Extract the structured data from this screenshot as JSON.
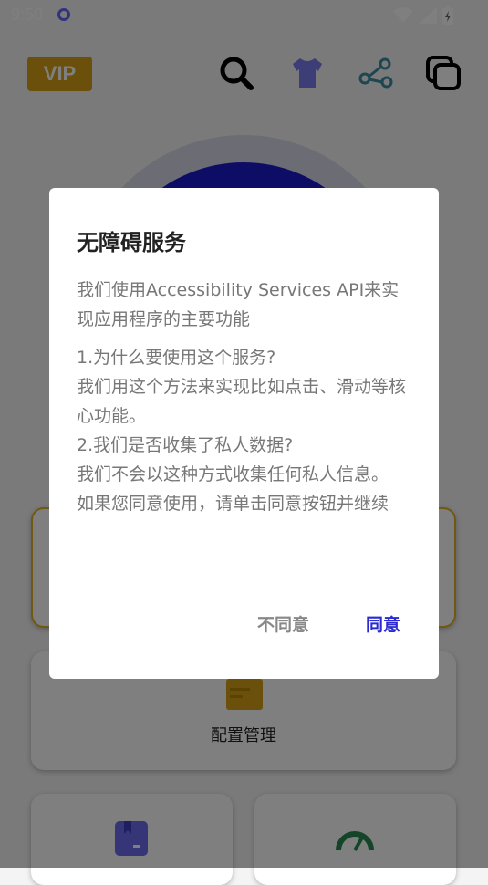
{
  "status_bar": {
    "time": "9:50"
  },
  "top_bar": {
    "vip_label": "VIP"
  },
  "cards": {
    "config_label": "配置管理"
  },
  "dialog": {
    "title": "无障碍服务",
    "intro": "我们使用Accessibility Services API来实现应用程序的主要功能",
    "lines": [
      "1.为什么要使用这个服务?",
      "我们用这个方法来实现比如点击、滑动等核心功能。",
      "2.我们是否收集了私人数据?",
      "我们不会以这种方式收集任何私人信息。",
      "如果您同意使用，请单击同意按钮并继续"
    ],
    "disagree_label": "不同意",
    "agree_label": "同意"
  },
  "colors": {
    "vip": "#d4a017",
    "accent_blue": "#2a2ad0",
    "circle": "#1a1acc",
    "gold_outline": "#e0b020"
  }
}
